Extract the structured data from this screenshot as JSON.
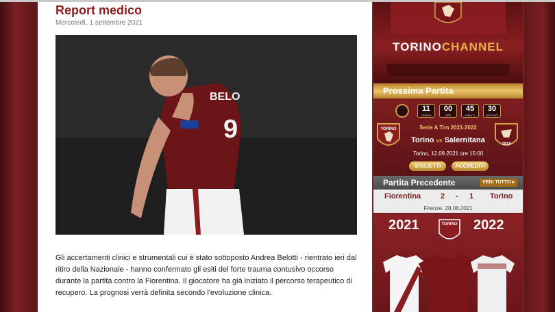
{
  "article": {
    "title": "Report medico",
    "date": "Mercoledì, 1 settembre 2021",
    "photo_caption_alt": "",
    "player_name_on_shirt": "BELO",
    "shirt_number": "9",
    "body": "Gli accertamenti clinici e strumentali cui è stato sottoposto Andrea Belotti - rientrato ieri dal ritiro della Nazionale - hanno confermato gli esiti del forte trauma contusivo occorso durante la partita contro la Fiorentina. Il giocatore ha già iniziato il percorso terapeutico di recupero. La prognosi verrà definita secondo l'evoluzione clinica."
  },
  "channel": {
    "logo_white": "TORINO",
    "logo_gold": "CHANNEL"
  },
  "next_match": {
    "heading": "Prossima Partita",
    "countdown": [
      {
        "value": "11",
        "unit": "GIORNI"
      },
      {
        "value": "00",
        "unit": "ORE"
      },
      {
        "value": "45",
        "unit": "MINUTI"
      },
      {
        "value": "30",
        "unit": "SECONDI"
      }
    ],
    "competition": "Serie A Tim 2021-2022",
    "home": "Torino",
    "vs": "vs",
    "away": "Salernitana",
    "when": "Torino, 12.09.2021 ore 15:00",
    "buttons": [
      "BIGLIETTI",
      "ACCREDITI"
    ],
    "home_crest_text": "TORINO",
    "away_crest_text": "1919"
  },
  "previous_match": {
    "heading": "Partita Precedente",
    "link": "VEDI TUTTO ▸",
    "home": "Fiorentina",
    "home_score": "2",
    "sep": "-",
    "away_score": "1",
    "away": "Torino",
    "place_date": "Firenze, 28.08.2021"
  },
  "shirts": {
    "year_left": "2021",
    "year_right": "2022",
    "crest_text": "TORINO"
  },
  "colors": {
    "brand": "#7a1f22",
    "title": "#8c1d1d",
    "gold": "#e8b04a"
  }
}
